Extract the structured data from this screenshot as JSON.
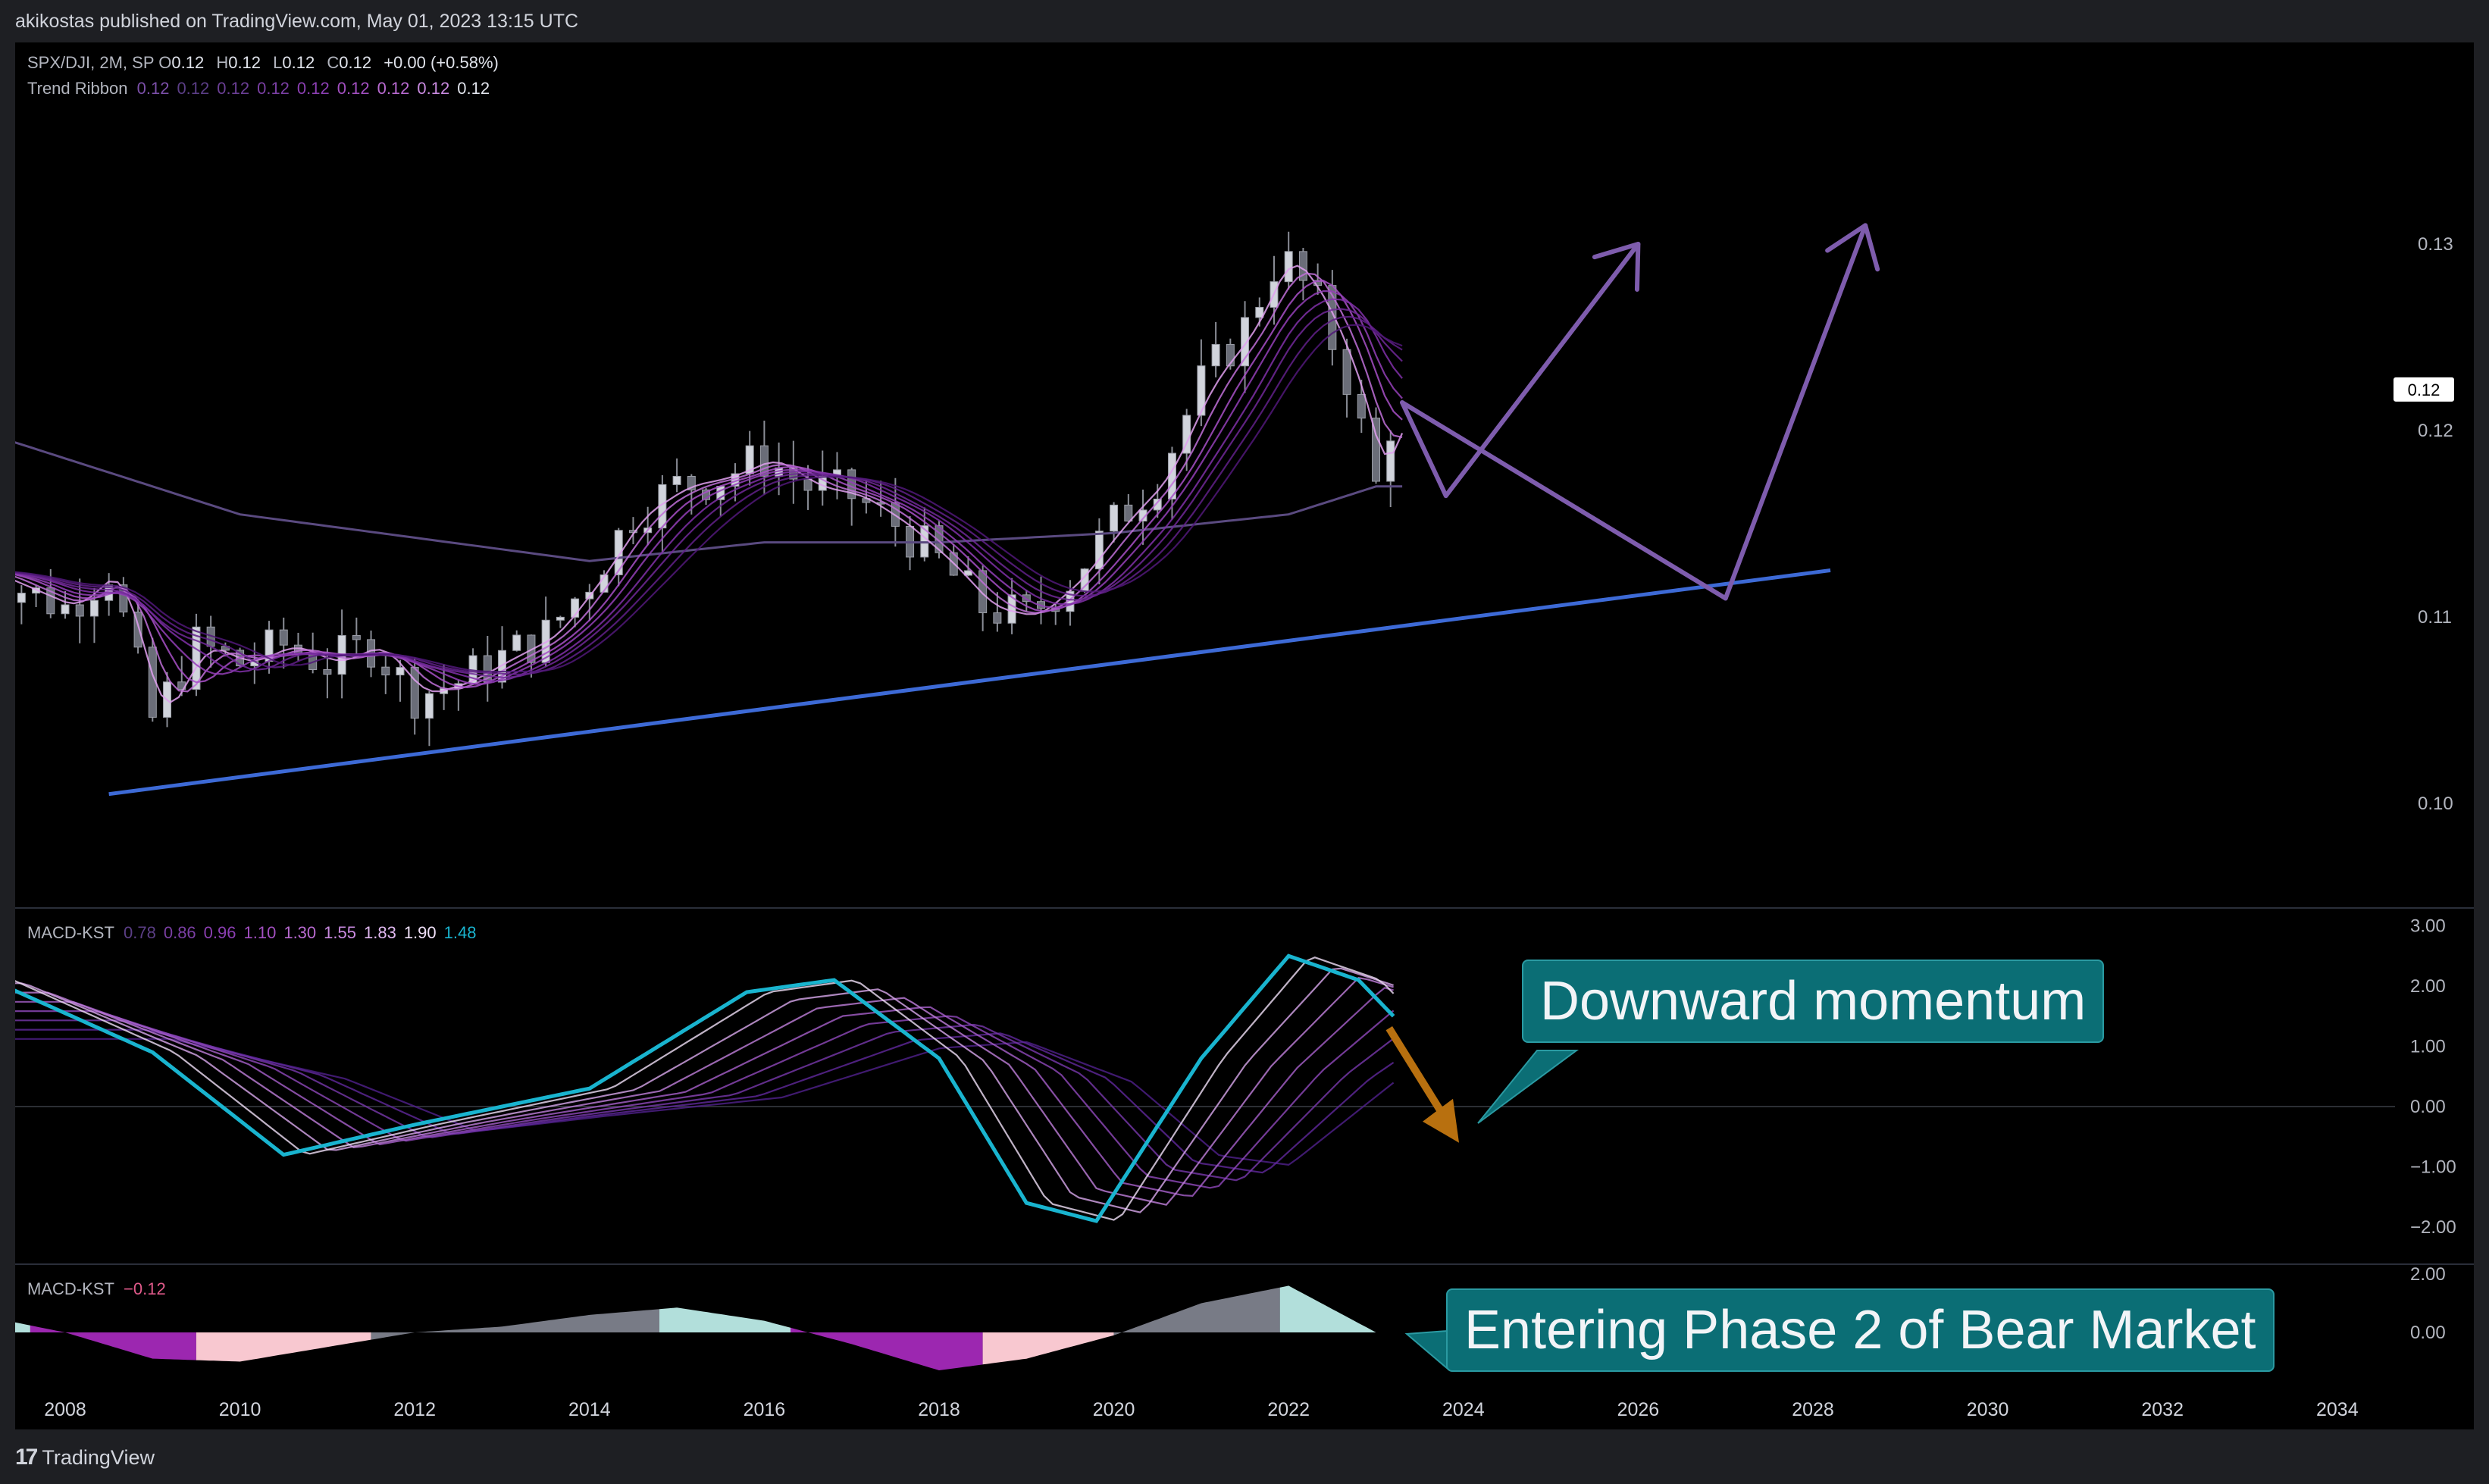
{
  "header": {
    "published_by": "akikostas published on TradingView.com, May 01, 2023 13:15 UTC"
  },
  "legend": {
    "symbol": "SPX/DJI, 2M, SP",
    "o_label": "O",
    "o_value": "0.12",
    "h_label": "H",
    "h_value": "0.12",
    "l_label": "L",
    "l_value": "0.12",
    "c_label": "C",
    "c_value": "0.12",
    "change": "+0.00 (+0.58%)",
    "ribbon_label": "Trend Ribbon",
    "ribbon_values": [
      "0.12",
      "0.12",
      "0.12",
      "0.12",
      "0.12",
      "0.12",
      "0.12",
      "0.12",
      "0.12"
    ],
    "macd_label": "MACD-KST",
    "macd_values": [
      "0.78",
      "0.86",
      "0.96",
      "1.10",
      "1.30",
      "1.55",
      "1.83",
      "1.90",
      "1.48"
    ],
    "hist_label": "MACD-KST",
    "hist_value": "−0.12"
  },
  "price_badge": "0.12",
  "callouts": {
    "momentum": "Downward momentum",
    "phase": "Entering Phase 2 of Bear Market"
  },
  "footer": {
    "brand": "TradingView"
  },
  "colors": {
    "background": "#000000",
    "candle_up": "#d1d4dc",
    "candle_down": "#6a6d78",
    "trendline": "#3d6ad6",
    "projection": "#7e5cad",
    "macd_main": "#19b4cf",
    "ribbon": "#9c27b0",
    "hist_pos_strong": "#b2dfdb",
    "hist_pos_weak": "#787b86",
    "hist_neg_strong": "#9c27b0",
    "hist_neg_weak": "#f8c8d0",
    "arrow": "#b8700f"
  },
  "chart_data": [
    {
      "type": "candlestick",
      "title": "SPX/DJI, 2M, SP",
      "x_axis_ticks": [
        "2008",
        "2010",
        "2012",
        "2014",
        "2016",
        "2018",
        "2020",
        "2022",
        "2024",
        "2026",
        "2028",
        "2030",
        "2032",
        "2034"
      ],
      "y_axis_ticks": [
        "0.13",
        "0.12",
        "0.11",
        "0.10"
      ],
      "y_range": [
        0.096,
        0.1365
      ],
      "series": [
        {
          "name": "SPX/DJI close",
          "x": [
            2007.0,
            2007.5,
            2008.0,
            2008.5,
            2009.0,
            2009.5,
            2010.0,
            2010.5,
            2011.0,
            2011.5,
            2012.0,
            2012.5,
            2013.0,
            2013.5,
            2014.0,
            2014.5,
            2015.0,
            2015.5,
            2016.0,
            2016.5,
            2017.0,
            2017.5,
            2018.0,
            2018.5,
            2019.0,
            2019.5,
            2020.0,
            2020.5,
            2021.0,
            2021.5,
            2021.9,
            2022.3,
            2022.7,
            2023.0,
            2023.25
          ],
          "values": [
            0.1125,
            0.1115,
            0.1105,
            0.1125,
            0.1045,
            0.1085,
            0.1075,
            0.1085,
            0.1075,
            0.1085,
            0.1058,
            0.1065,
            0.1078,
            0.109,
            0.112,
            0.1155,
            0.117,
            0.1175,
            0.1185,
            0.117,
            0.1165,
            0.115,
            0.113,
            0.1105,
            0.11,
            0.112,
            0.115,
            0.1175,
            0.1225,
            0.1255,
            0.1295,
            0.127,
            0.1225,
            0.117,
            0.122
          ]
        },
        {
          "name": "Trend Ribbon slow",
          "x": [
            2007.0,
            2010.0,
            2014.0,
            2016.0,
            2018.0,
            2020.0,
            2022.0,
            2023.0
          ],
          "values": [
            0.12,
            0.1155,
            0.113,
            0.114,
            0.114,
            0.1145,
            0.1155,
            0.117
          ]
        }
      ],
      "trendline": {
        "x": [
          2008.5,
          2028.2
        ],
        "values": [
          0.1005,
          0.1125
        ]
      },
      "projection": {
        "x": [
          2023.3,
          2023.8,
          2026.0,
          2027.0,
          2028.6,
          2030.6
        ],
        "values": [
          0.1215,
          0.1165,
          0.13,
          0.111,
          0.131,
          0.116
        ]
      }
    },
    {
      "type": "line",
      "title": "MACD-KST",
      "y_axis_ticks": [
        "3.00",
        "2.00",
        "1.00",
        "0.00",
        "−1.00",
        "−2.00"
      ],
      "y_range": [
        -2.6,
        3.0
      ],
      "series": [
        {
          "name": "MACD-KST",
          "x": [
            2007.0,
            2009.0,
            2010.5,
            2012.0,
            2014.0,
            2015.8,
            2016.8,
            2018.0,
            2019.0,
            2019.8,
            2021.0,
            2022.0,
            2022.8,
            2023.2
          ],
          "values": [
            2.2,
            0.9,
            -0.8,
            -0.3,
            0.3,
            1.9,
            2.1,
            0.8,
            -1.6,
            -1.9,
            0.8,
            2.5,
            2.1,
            1.5
          ]
        }
      ]
    },
    {
      "type": "bar",
      "title": "MACD-KST",
      "y_axis_ticks": [
        "2.00",
        "0.00"
      ],
      "y_range": [
        -1.4,
        2.0
      ],
      "series": [
        {
          "name": "MACD-KST histogram",
          "x": [
            2007.0,
            2008.0,
            2009.0,
            2010.0,
            2011.0,
            2012.0,
            2013.0,
            2014.0,
            2015.0,
            2016.0,
            2017.0,
            2018.0,
            2019.0,
            2020.0,
            2021.0,
            2022.0,
            2023.0
          ],
          "values": [
            0.6,
            0.0,
            -0.9,
            -1.0,
            -0.5,
            0.0,
            0.2,
            0.6,
            0.85,
            0.4,
            -0.4,
            -1.3,
            -0.9,
            -0.1,
            1.0,
            1.6,
            0.0
          ]
        }
      ]
    }
  ]
}
